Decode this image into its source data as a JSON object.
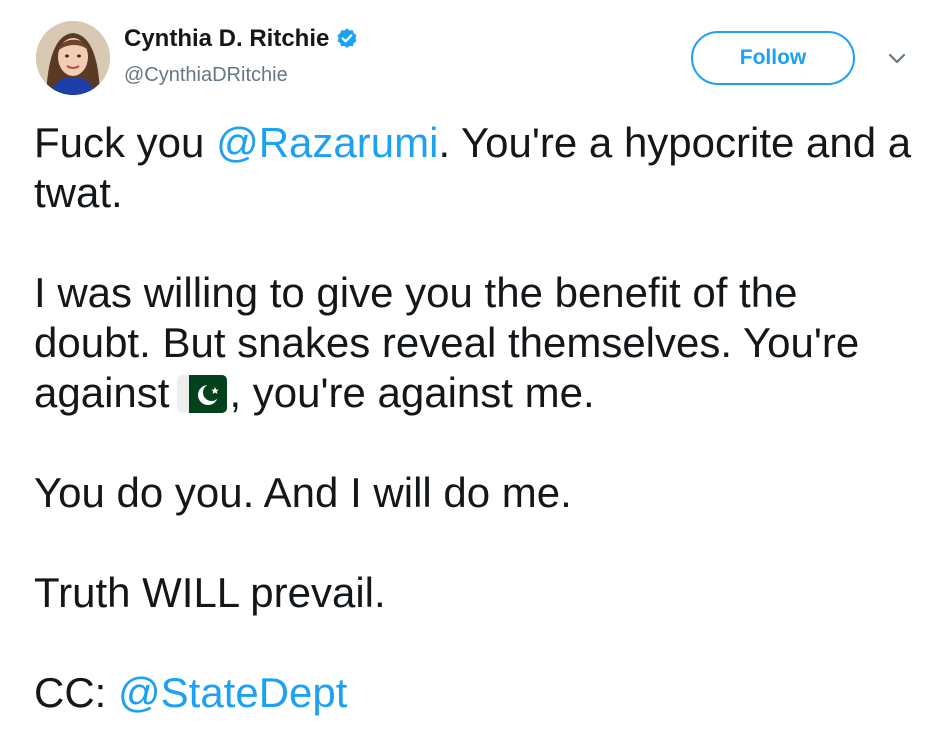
{
  "header": {
    "display_name": "Cynthia D. Ritchie",
    "screen_name": "@CynthiaDRitchie",
    "follow_label": "Follow",
    "verified_icon": "verified-badge-icon",
    "menu_icon": "chevron-down-icon",
    "avatar": "profile-photo"
  },
  "tweet": {
    "p1_lead": "Fuck you ",
    "p1_mention": "@Razarumi",
    "p1_tail": ". You're a hypocrite and a twat.",
    "p2_lead": "I was willing to give you the benefit of the doubt. But snakes reveal themselves. You're against",
    "p2_emoji": "flag-pakistan",
    "p2_tail": ", you're against me.",
    "p3": "You do you. And I will do me.",
    "p4": "Truth WILL prevail.",
    "p5_lead": "CC: ",
    "p5_mention": "@StateDept"
  },
  "colors": {
    "link": "#1da1f2",
    "text": "#14171a",
    "secondary": "#657786",
    "flag_green": "#01411c"
  }
}
